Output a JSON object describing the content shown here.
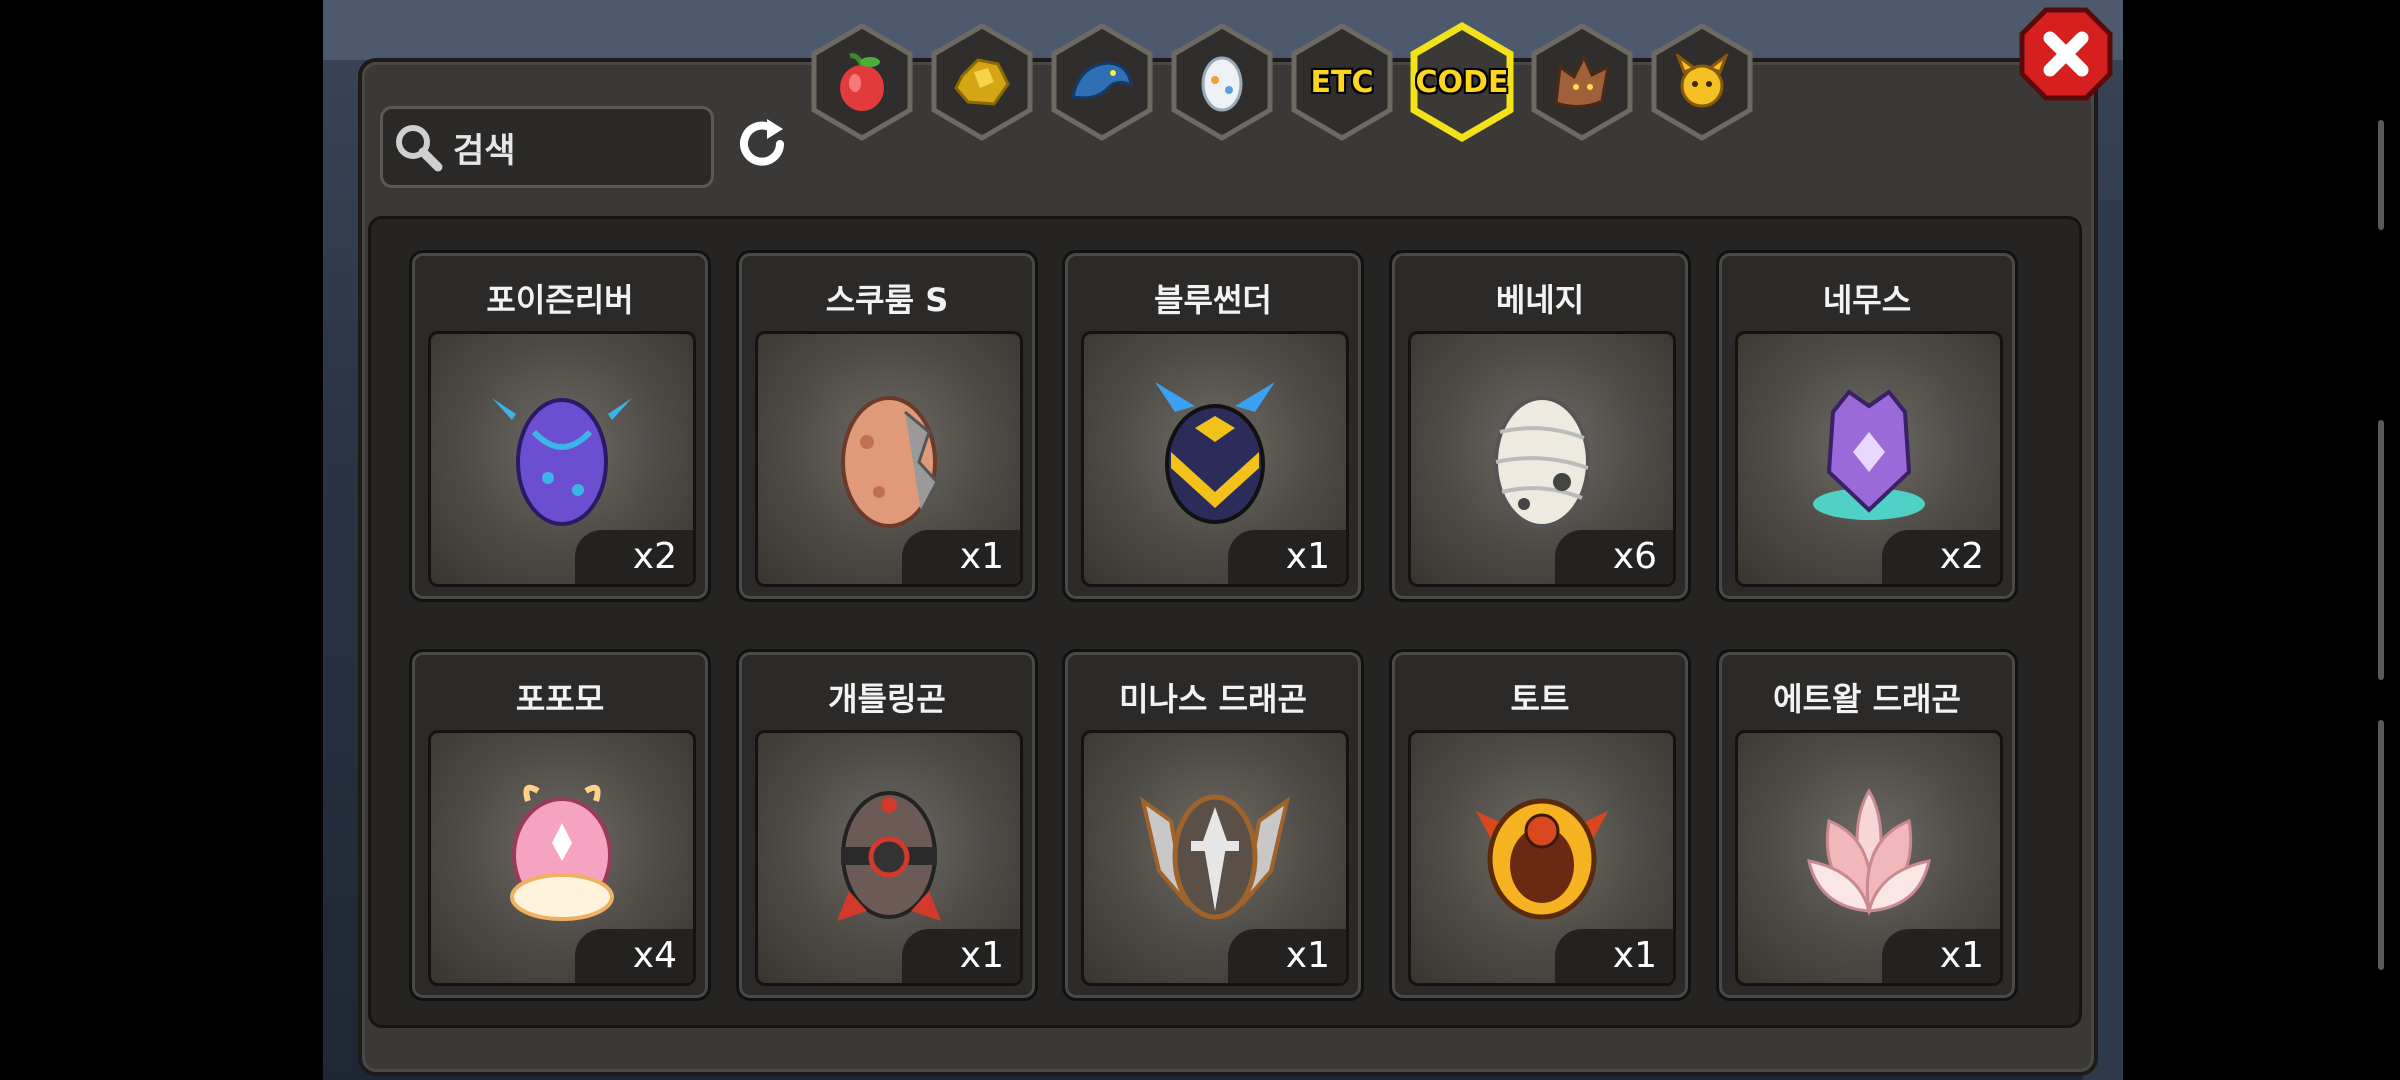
{
  "search": {
    "placeholder": "검색"
  },
  "tabs": [
    {
      "id": "fruit",
      "icon": "fruit-icon",
      "label": ""
    },
    {
      "id": "gold",
      "icon": "gold-ore-icon",
      "label": ""
    },
    {
      "id": "dragon-head",
      "icon": "blue-dragon-head-icon",
      "label": ""
    },
    {
      "id": "egg",
      "icon": "egg-icon",
      "label": ""
    },
    {
      "id": "etc",
      "icon": "",
      "label": "ETC"
    },
    {
      "id": "code",
      "icon": "",
      "label": "CODE",
      "selected": true
    },
    {
      "id": "beast",
      "icon": "beast-head-icon",
      "label": ""
    },
    {
      "id": "pet",
      "icon": "horned-pet-icon",
      "label": ""
    }
  ],
  "items": [
    {
      "name": "포이즌리버",
      "count": "x2",
      "egg_icon": "purple-spiked-egg-icon",
      "colors": [
        "#6b4fd0",
        "#3cb4e6"
      ]
    },
    {
      "name": "스쿠룸 S",
      "count": "x1",
      "egg_icon": "cracked-orange-egg-icon",
      "colors": [
        "#e09a7a",
        "#9a9a9a"
      ]
    },
    {
      "name": "블루썬더",
      "count": "x1",
      "egg_icon": "armored-thunder-egg-icon",
      "colors": [
        "#2c2c5a",
        "#f2c21b"
      ]
    },
    {
      "name": "베네지",
      "count": "x6",
      "egg_icon": "bandaged-egg-icon",
      "colors": [
        "#eeeae0",
        "#555555"
      ]
    },
    {
      "name": "네무스",
      "count": "x2",
      "egg_icon": "crystal-purple-egg-icon",
      "colors": [
        "#9a6ad8",
        "#4fd1c5"
      ]
    },
    {
      "name": "포포모",
      "count": "x4",
      "egg_icon": "pink-fluffy-egg-icon",
      "colors": [
        "#f5a3c0",
        "#ffd28a"
      ]
    },
    {
      "name": "개틀링곤",
      "count": "x1",
      "egg_icon": "mechanical-egg-icon",
      "colors": [
        "#6b5a55",
        "#d33a2c"
      ]
    },
    {
      "name": "미나스 드래곤",
      "count": "x1",
      "egg_icon": "winged-silver-egg-icon",
      "colors": [
        "#c8c8c8",
        "#a0642a"
      ]
    },
    {
      "name": "토트",
      "count": "x1",
      "egg_icon": "fire-ring-egg-icon",
      "colors": [
        "#d9471f",
        "#f5b322"
      ]
    },
    {
      "name": "에트왈 드래곤",
      "count": "x1",
      "egg_icon": "lotus-egg-icon",
      "colors": [
        "#f7d6d8",
        "#f2b7bb"
      ]
    }
  ]
}
